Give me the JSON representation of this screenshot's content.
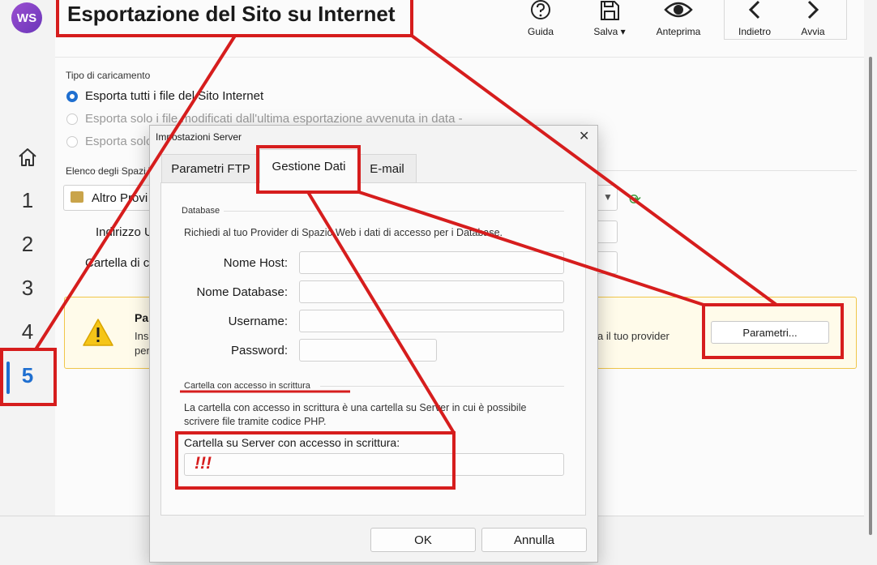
{
  "app": {
    "logo_text": "WS",
    "page_title": "Esportazione del Sito su Internet",
    "toolbar": [
      {
        "id": "help",
        "label": "Guida",
        "icon": "help-circle-icon"
      },
      {
        "id": "save",
        "label": "Salva ▾",
        "icon": "floppy-disk-icon"
      },
      {
        "id": "preview",
        "label": "Anteprima",
        "icon": "eye-icon"
      },
      {
        "id": "back",
        "label": "Indietro",
        "icon": "chevron-left-icon"
      },
      {
        "id": "start",
        "label": "Avvia",
        "icon": "chevron-right-icon"
      }
    ],
    "steps": [
      "1",
      "2",
      "3",
      "4",
      "5"
    ],
    "active_step": "5"
  },
  "main": {
    "upload_type_label": "Tipo di caricamento",
    "radio_all": "Esporta tutti i file del Sito Internet",
    "radio_modified": "Esporta solo i file modificati dall'ultima esportazione avvenuta in data -",
    "radio_third": "Esporta solo",
    "spaces_label": "Elenco degli Spazi W",
    "space_selected": "Altro Provi",
    "address_label": "Indirizzo U",
    "folder_label": "Cartella di c",
    "warning_title": "Pa",
    "warning_line1": "Ins",
    "warning_line2": "per",
    "warning_tail": "a il tuo provider",
    "params_button": "Parametri..."
  },
  "dialog": {
    "title": "Impostazioni Server",
    "close": "✕",
    "tabs": [
      "Parametri FTP",
      "Gestione Dati",
      "E-mail"
    ],
    "active_tab": "Gestione Dati",
    "database_group": "Database",
    "database_desc": "Richiedi al tuo Provider di Spazio Web i dati di accesso per i Database.",
    "fields": [
      {
        "label": "Nome Host:",
        "value": ""
      },
      {
        "label": "Nome Database:",
        "value": ""
      },
      {
        "label": "Username:",
        "value": ""
      },
      {
        "label": "Password:",
        "value": ""
      }
    ],
    "write_group": "Cartella con accesso in scrittura",
    "write_desc1": "La cartella con accesso in scrittura è una cartella su Server in cui è possibile",
    "write_desc2": "scrivere file tramite codice PHP.",
    "write_label": "Cartella su Server con accesso in scrittura:",
    "write_value": "!!!",
    "ok": "OK",
    "cancel": "Annulla"
  },
  "colors": {
    "accent": "#1f6fd0",
    "annotation_red": "#d61d1d",
    "warning_border": "#f0c64a"
  }
}
